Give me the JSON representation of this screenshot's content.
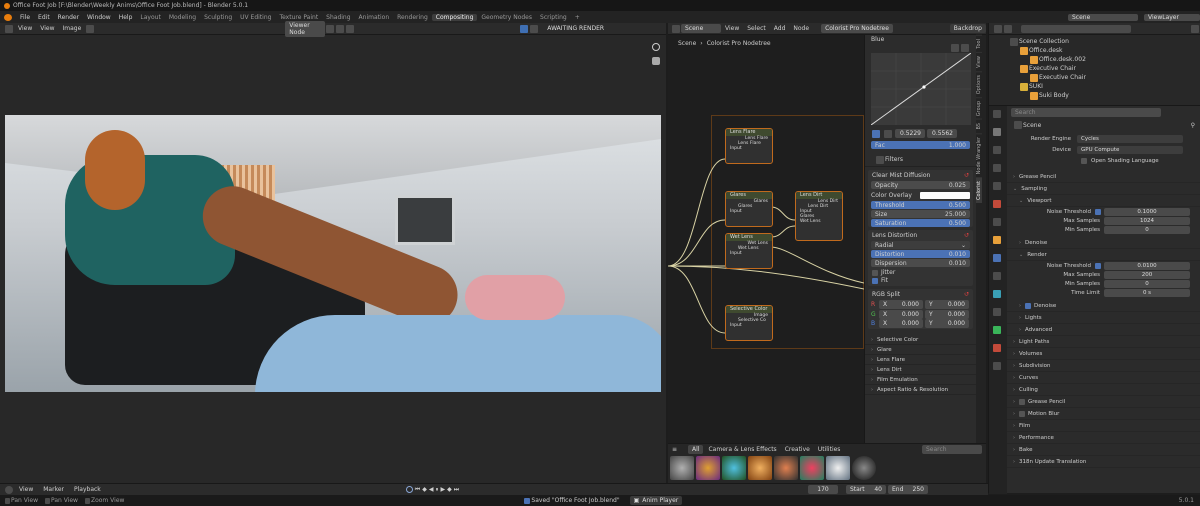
{
  "window_title": "Office Foot Job [F:\\Blender\\Weekly Anims\\Office Foot Job.blend] - Blender 5.0.1",
  "menus": [
    "File",
    "Edit",
    "Render",
    "Window",
    "Help"
  ],
  "workspaces": [
    "Layout",
    "Modeling",
    "Sculpting",
    "UV Editing",
    "Texture Paint",
    "Shading",
    "Animation",
    "Rendering",
    "Compositing",
    "Geometry Nodes",
    "Scripting"
  ],
  "active_workspace": "Compositing",
  "scene": {
    "label": "Scene",
    "view_layer": "ViewLayer"
  },
  "image_editor": {
    "menus": [
      "View",
      "View",
      "Image"
    ],
    "image_name": "Viewer Node",
    "status": "AWAITING RENDER"
  },
  "node_editor": {
    "editor_type": "Scene",
    "menus": [
      "View",
      "Select",
      "Add",
      "Node"
    ],
    "node_tree": "Colorist Pro Nodetree",
    "backdrop": "Backdrop",
    "breadcrumb": [
      "Scene",
      "Colorist Pro Nodetree"
    ],
    "nodes": [
      {
        "title": "Lens Flare",
        "outputs": [
          "Lens Flare"
        ],
        "inner": "Lens Flare",
        "inputs": [
          "Input"
        ]
      },
      {
        "title": "Glares",
        "outputs": [
          "Glares"
        ],
        "inner": "Glares",
        "inputs": [
          "Input"
        ]
      },
      {
        "title": "Lens Dirt",
        "outputs": [
          "Lens Dirt"
        ],
        "inner": "Lens Dirt",
        "inputs": [
          "Input",
          "Glares",
          "Wet Lens"
        ]
      },
      {
        "title": "Wet Lens",
        "outputs": [
          "Wet Lens"
        ],
        "inner": "Wet Lens",
        "inputs": [
          "Input"
        ]
      },
      {
        "title": "Selective Color",
        "outputs": [
          "Image"
        ],
        "inner": "Selective Co",
        "inputs": [
          "Input"
        ]
      }
    ]
  },
  "sidebar": {
    "group_title": "Colorist Pro Nodetree",
    "channel": "Blue",
    "curve_values": [
      "0.5229",
      "0.5562"
    ],
    "fac_label": "Fac",
    "fac_value": "1.000",
    "tabs": [
      "Tool",
      "View",
      "Options",
      "Group",
      "BS",
      "Node Wrangler",
      "Colorist"
    ],
    "filters_title": "Filters",
    "clear_mist": {
      "title": "Clear Mist Diffusion",
      "opacity_label": "Opacity",
      "opacity": "0.025",
      "overlay_label": "Color Overlay",
      "threshold_label": "Threshold",
      "threshold": "0.500",
      "size_label": "Size",
      "size": "25.000",
      "saturation_label": "Saturation",
      "saturation": "0.500"
    },
    "lens_distortion": {
      "title": "Lens Distortion",
      "type": "Radial",
      "distortion_label": "Distortion",
      "distortion": "0.010",
      "dispersion_label": "Dispersion",
      "dispersion": "0.010",
      "jitter_label": "Jitter",
      "fit_label": "Fit"
    },
    "rgb_split": {
      "title": "RGB Split",
      "rows": [
        {
          "ch": "R",
          "x": "0.000",
          "y": "0.000"
        },
        {
          "ch": "G",
          "x": "0.000",
          "y": "0.000"
        },
        {
          "ch": "B",
          "x": "0.000",
          "y": "0.000"
        }
      ],
      "x_label": "X",
      "y_label": "Y"
    },
    "collapsed": [
      "Selective Color",
      "Glare",
      "Lens Flare",
      "Lens Dirt",
      "Film Emulation",
      "Aspect Ratio & Resolution"
    ]
  },
  "asset_shelf": {
    "tabs": [
      "All",
      "Camera & Lens Effects",
      "Creative",
      "Utilities"
    ],
    "search_placeholder": "Search"
  },
  "outliner": {
    "search_placeholder": "",
    "items": [
      {
        "name": "Scene Collection",
        "indent": 0
      },
      {
        "name": "Office.desk",
        "indent": 1
      },
      {
        "name": "Office.desk.002",
        "indent": 2
      },
      {
        "name": "Executive Chair",
        "indent": 1
      },
      {
        "name": "Executive Chair",
        "indent": 2
      },
      {
        "name": "SUKI",
        "indent": 1
      },
      {
        "name": "Suki Body",
        "indent": 2
      }
    ]
  },
  "properties": {
    "search_placeholder": "Search",
    "breadcrumb": "Scene",
    "render_engine_label": "Render Engine",
    "render_engine": "Cycles",
    "device_label": "Device",
    "device": "GPU Compute",
    "osl_label": "Open Shading Language",
    "sections": {
      "grease_pencil": "Grease Pencil",
      "sampling": "Sampling",
      "viewport": "Viewport",
      "denoise": "Denoise",
      "render": "Render",
      "denoise2": "Denoise",
      "lights": "Lights",
      "advanced": "Advanced",
      "light_paths": "Light Paths",
      "volumes": "Volumes",
      "subdivision": "Subdivision",
      "curves": "Curves",
      "culling": "Culling",
      "grease_pencil2": "Grease Pencil",
      "motion_blur": "Motion Blur",
      "film": "Film",
      "performance": "Performance",
      "bake": "Bake",
      "addon": "318n Update Translation"
    },
    "viewport": {
      "noise_label": "Noise Threshold",
      "noise": "0.1000",
      "max_label": "Max Samples",
      "max": "1024",
      "min_label": "Min Samples",
      "min": "0"
    },
    "render": {
      "noise_label": "Noise Threshold",
      "noise": "0.0100",
      "max_label": "Max Samples",
      "max": "200",
      "min_label": "Min Samples",
      "min": "0",
      "time_label": "Time Limit",
      "time": "0 s"
    }
  },
  "timeline": {
    "menus": [
      "View",
      "Marker",
      "Playback"
    ],
    "frame": "170",
    "start_label": "Start",
    "start": "40",
    "end_label": "End",
    "end": "250"
  },
  "status_bar": {
    "hints": [
      "Pan View",
      "Pan View",
      "Zoom View"
    ],
    "message": "Saved \"Office Foot Job.blend\"",
    "anim_player": "Anim Player",
    "version": "5.0.1"
  },
  "colors": {
    "accent": "#4b72b5",
    "node_border": "#c06a1d",
    "background": "#1d1d1d"
  }
}
